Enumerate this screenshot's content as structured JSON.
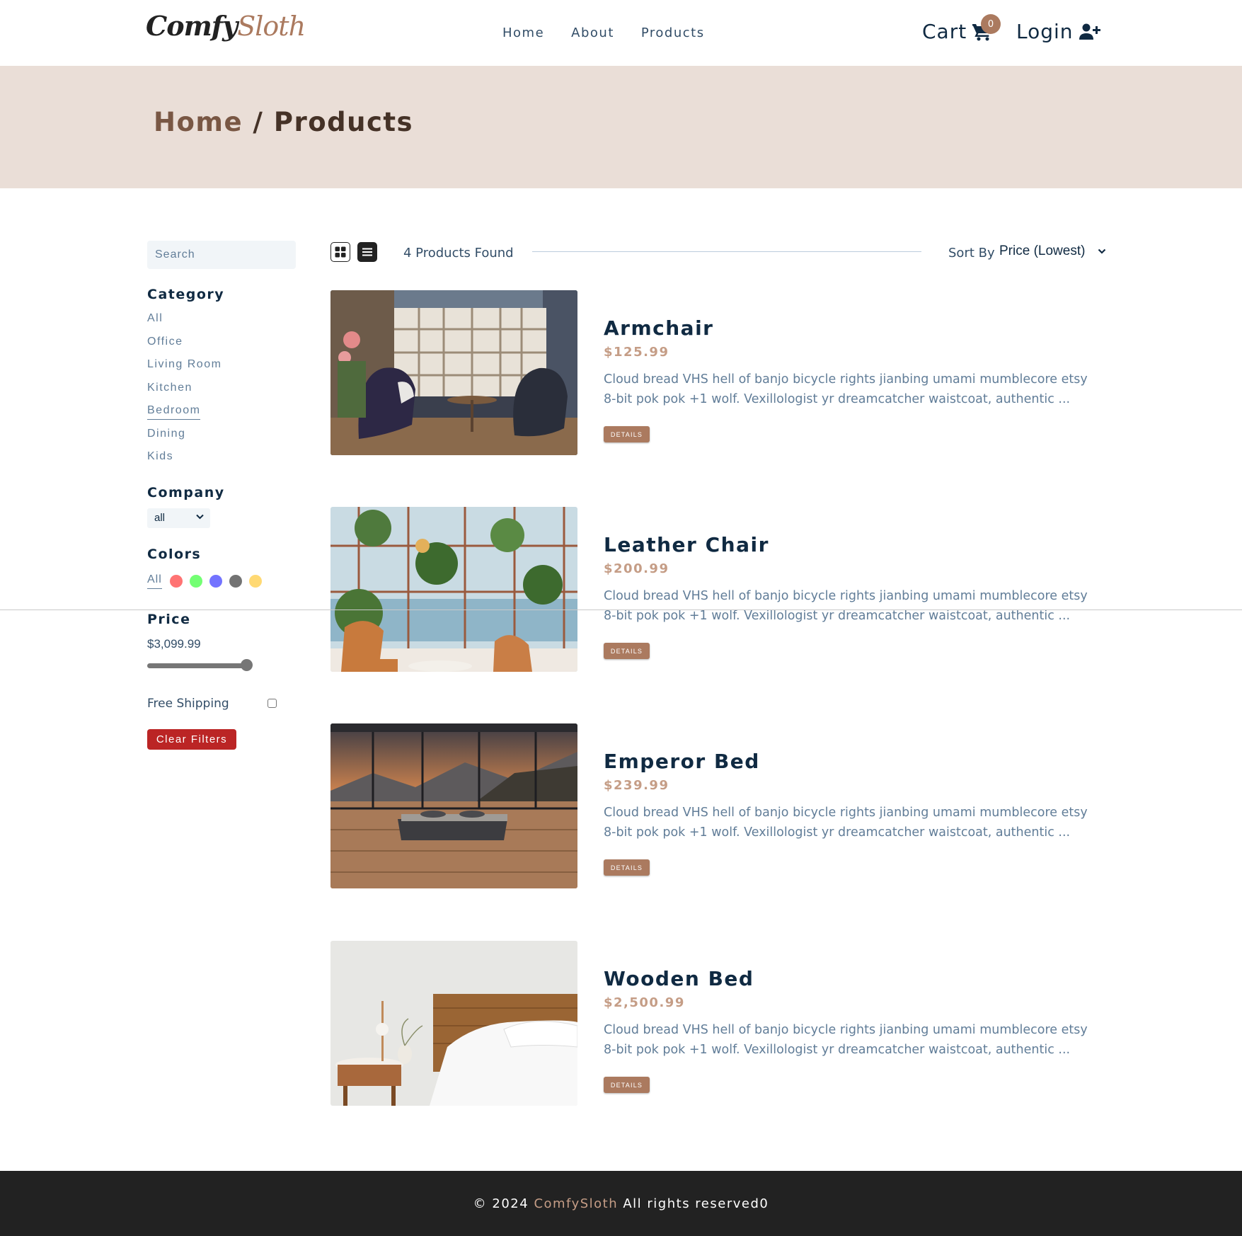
{
  "nav": {
    "logo_part1": "Comfy",
    "logo_part2": "Sloth",
    "links": [
      "Home",
      "About",
      "Products"
    ],
    "cart_label": "Cart",
    "cart_count": "0",
    "login_label": "Login"
  },
  "hero": {
    "home": "Home",
    "separator": " / ",
    "current": "Products"
  },
  "filters": {
    "search_placeholder": "Search",
    "category_title": "Category",
    "categories": [
      "All",
      "Office",
      "Living Room",
      "Kitchen",
      "Bedroom",
      "Dining",
      "Kids"
    ],
    "active_category": "Bedroom",
    "company_title": "Company",
    "company_value": "all",
    "colors_title": "Colors",
    "colors_all": "All",
    "colors": [
      "#ff0000",
      "#00ff00",
      "#0000ff",
      "#000000",
      "#ffb900"
    ],
    "price_title": "Price",
    "price_value": "$3,099.99",
    "price_fraction": 1.0,
    "shipping_label": "Free Shipping",
    "shipping_checked": false,
    "clear_label": "Clear Filters"
  },
  "toolbar": {
    "found": "4 Products Found",
    "sort_label": "Sort By",
    "sort_value": "Price (Lowest)"
  },
  "products": [
    {
      "name": "Armchair",
      "price": "$125.99",
      "desc": "Cloud bread VHS hell of banjo bicycle rights jianbing umami mumblecore etsy 8-bit pok pok +1 wolf. Vexillologist yr dreamcatcher waistcoat, authentic ...",
      "button": "DETAILS"
    },
    {
      "name": "Leather Chair",
      "price": "$200.99",
      "desc": "Cloud bread VHS hell of banjo bicycle rights jianbing umami mumblecore etsy 8-bit pok pok +1 wolf. Vexillologist yr dreamcatcher waistcoat, authentic ...",
      "button": "DETAILS"
    },
    {
      "name": "Emperor Bed",
      "price": "$239.99",
      "desc": "Cloud bread VHS hell of banjo bicycle rights jianbing umami mumblecore etsy 8-bit pok pok +1 wolf. Vexillologist yr dreamcatcher waistcoat, authentic ...",
      "button": "DETAILS"
    },
    {
      "name": "Wooden Bed",
      "price": "$2,500.99",
      "desc": "Cloud bread VHS hell of banjo bicycle rights jianbing umami mumblecore etsy 8-bit pok pok +1 wolf. Vexillologist yr dreamcatcher waistcoat, authentic ...",
      "button": "DETAILS"
    }
  ],
  "footer": {
    "prefix": "© 2024 ",
    "brand": "ComfySloth",
    "suffix": " All rights reserved0"
  }
}
